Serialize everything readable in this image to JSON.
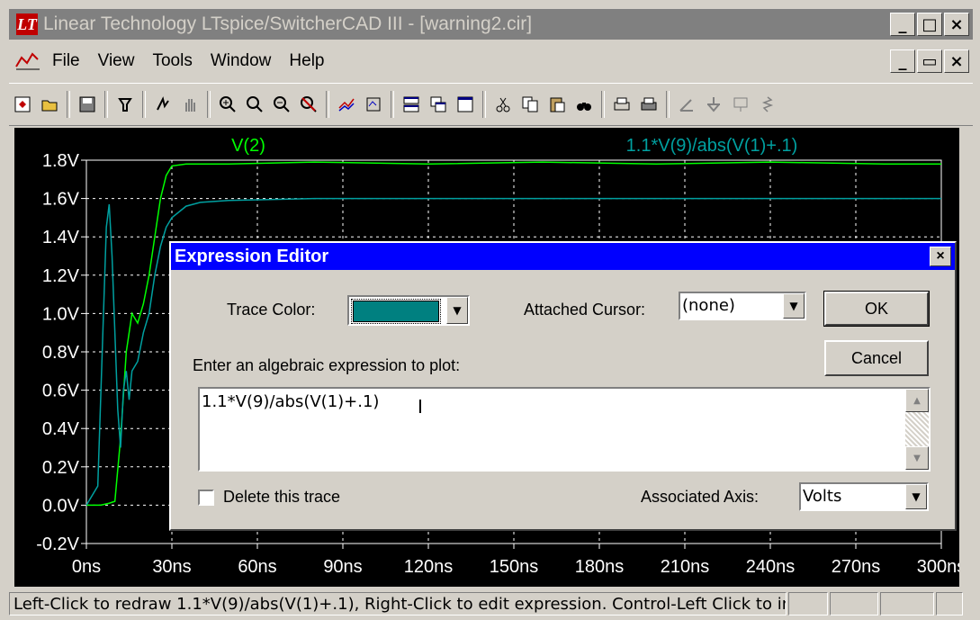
{
  "window": {
    "title": "Linear Technology LTspice/SwitcherCAD III - [warning2.cir]",
    "logo_text": "LT",
    "minimize": "_",
    "maximize": "□",
    "close": "×"
  },
  "menu": {
    "items": [
      "File",
      "View",
      "Tools",
      "Window",
      "Help"
    ],
    "mdi_min": "_",
    "mdi_restore": "▭",
    "mdi_close": "×"
  },
  "toolbar": {
    "icons": [
      "new-schematic-icon",
      "open-icon",
      "save-icon",
      "control-panel-icon",
      "run-icon",
      "pan-icon",
      "zoom-in-icon",
      "zoom-fit-icon",
      "zoom-out-icon",
      "zoom-cancel-icon",
      "autorange-icon",
      "mark-unused-icon",
      "tile-horizontal-icon",
      "cascade-icon",
      "arrange-icons-icon",
      "cut-icon",
      "copy-icon",
      "paste-icon",
      "find-icon",
      "print-preview-icon",
      "print-icon",
      "wire-icon",
      "ground-icon",
      "label-icon",
      "resistor-icon"
    ]
  },
  "plot": {
    "trace_labels": [
      {
        "text": "V(2)",
        "color": "#00ff00"
      },
      {
        "text": "1.1*V(9)/abs(V(1)+.1)",
        "color": "#00a0a0"
      }
    ],
    "y_ticks": [
      "1.8V",
      "1.6V",
      "1.4V",
      "1.2V",
      "1.0V",
      "0.8V",
      "0.6V",
      "0.4V",
      "0.2V",
      "0.0V",
      "-0.2V"
    ],
    "x_ticks": [
      "0ns",
      "30ns",
      "60ns",
      "90ns",
      "120ns",
      "150ns",
      "180ns",
      "210ns",
      "240ns",
      "270ns",
      "300ns"
    ]
  },
  "chart_data": {
    "type": "line",
    "xlim": [
      0,
      300
    ],
    "ylim": [
      -0.2,
      1.8
    ],
    "x_unit": "ns",
    "y_unit": "V",
    "grid": true,
    "series": [
      {
        "name": "V(2)",
        "color": "#00ff00",
        "x": [
          0,
          5,
          8,
          10,
          12,
          14,
          16,
          18,
          20,
          22,
          24,
          26,
          28,
          30,
          35,
          40,
          50,
          80,
          120,
          160,
          200,
          240,
          280,
          300
        ],
        "y": [
          0.0,
          0.0,
          0.01,
          0.02,
          0.35,
          0.8,
          1.0,
          0.95,
          1.05,
          1.2,
          1.4,
          1.6,
          1.72,
          1.77,
          1.78,
          1.78,
          1.78,
          1.79,
          1.78,
          1.79,
          1.78,
          1.79,
          1.78,
          1.78
        ]
      },
      {
        "name": "1.1*V(9)/abs(V(1)+.1)",
        "color": "#00a0a0",
        "x": [
          0,
          4,
          6,
          7,
          8,
          9,
          10,
          11,
          12,
          13,
          14,
          15,
          16,
          18,
          20,
          22,
          24,
          26,
          28,
          30,
          35,
          40,
          50,
          80,
          120,
          160,
          200,
          240,
          280,
          300
        ],
        "y": [
          0.0,
          0.1,
          1.0,
          1.45,
          1.57,
          1.3,
          0.9,
          0.5,
          0.3,
          0.6,
          0.7,
          0.55,
          0.7,
          0.75,
          0.9,
          1.0,
          1.2,
          1.35,
          1.45,
          1.5,
          1.56,
          1.58,
          1.59,
          1.6,
          1.6,
          1.6,
          1.6,
          1.6,
          1.6,
          1.6
        ]
      }
    ]
  },
  "dialog": {
    "title": "Expression Editor",
    "close": "×",
    "trace_color_label": "Trace Color:",
    "trace_color_value": "#008080",
    "attached_cursor_label": "Attached Cursor:",
    "attached_cursor_value": "(none)",
    "ok_label": "OK",
    "cancel_label": "Cancel",
    "expression_prompt": "Enter an algebraic expression to plot:",
    "expression_value": "1.1*V(9)/abs(V(1)+.1)",
    "delete_trace_label": "Delete this trace",
    "associated_axis_label": "Associated Axis:",
    "associated_axis_value": "Volts"
  },
  "status": {
    "text": "Left-Click to redraw 1.1*V(9)/abs(V(1)+.1),  Right-Click to edit expression. Control-Left Click to integrate trace."
  }
}
